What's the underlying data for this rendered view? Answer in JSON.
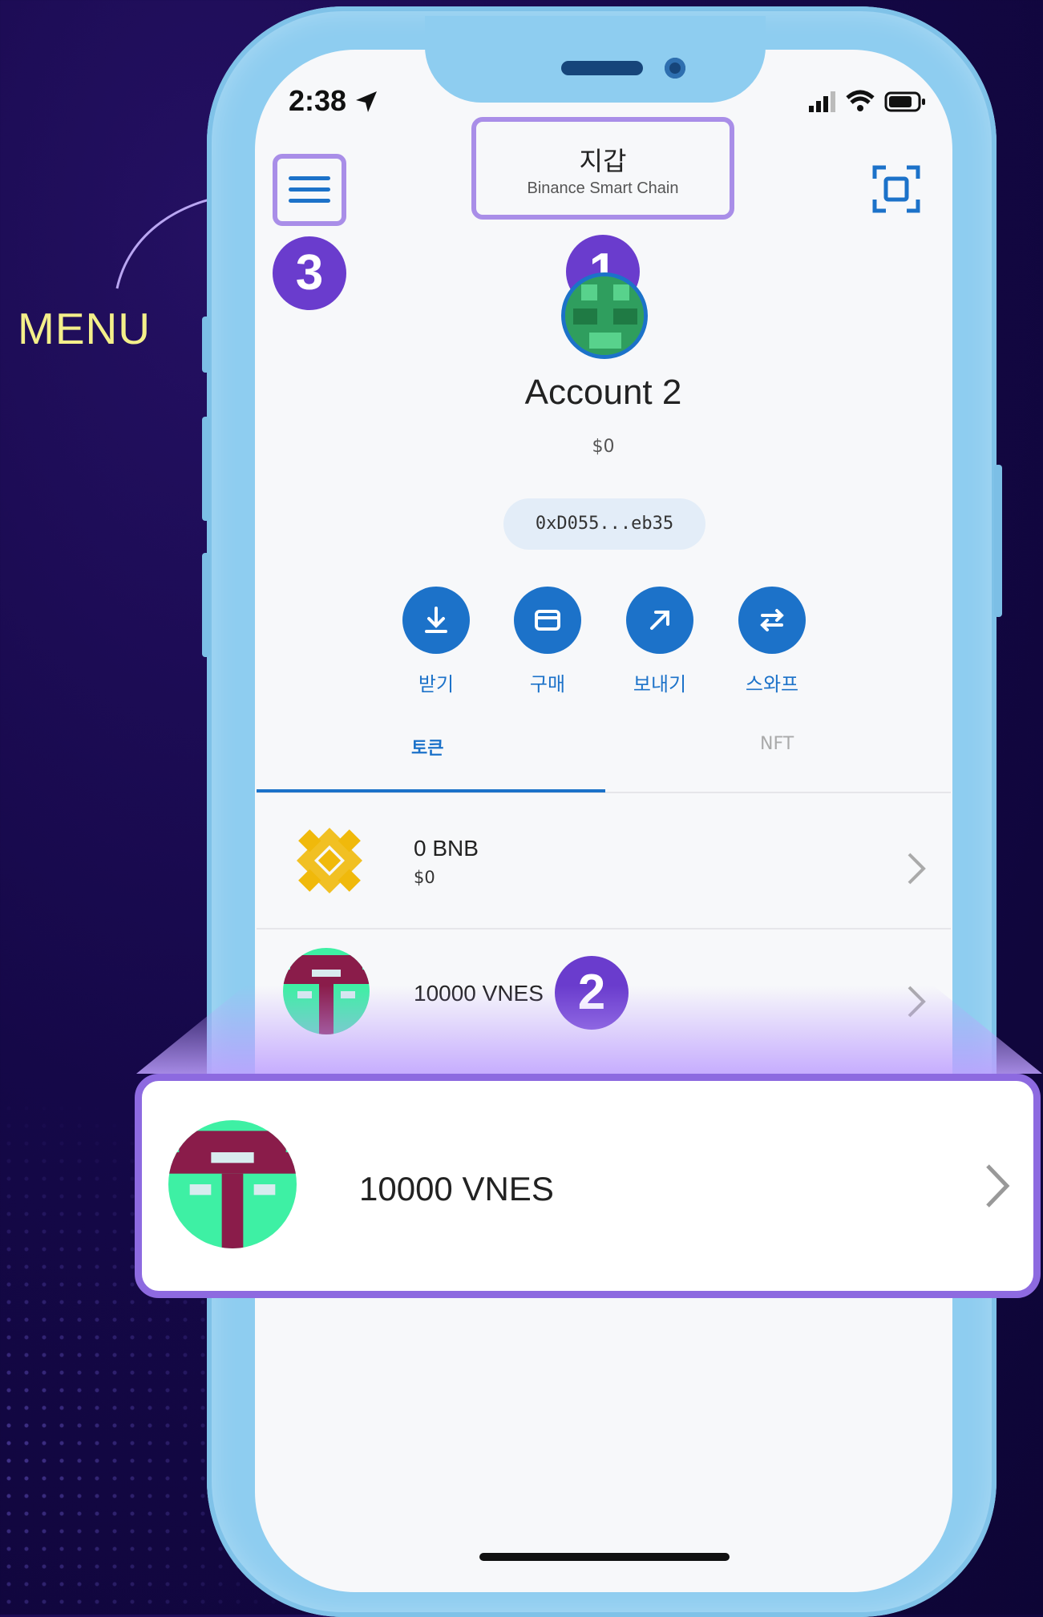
{
  "annotation": {
    "menu_label": "MENU",
    "badges": [
      "1",
      "2",
      "3"
    ]
  },
  "status_bar": {
    "time": "2:38"
  },
  "header": {
    "title": "지갑",
    "network": "Binance Smart Chain"
  },
  "account": {
    "name": "Account 2",
    "balance": "$0",
    "address": "0xD055...eb35"
  },
  "actions": [
    {
      "label": "받기",
      "icon": "receive-arrow-icon"
    },
    {
      "label": "구매",
      "icon": "card-icon"
    },
    {
      "label": "보내기",
      "icon": "send-arrow-icon"
    },
    {
      "label": "스와프",
      "icon": "swap-icon"
    }
  ],
  "tabs": [
    {
      "label": "토큰",
      "active": true
    },
    {
      "label": "NFT",
      "active": false
    }
  ],
  "tokens": [
    {
      "amount": "0 BNB",
      "fiat": "$0",
      "icon": "bnb-logo-icon"
    },
    {
      "amount": "10000 VNES",
      "fiat": "",
      "icon": "vnes-logo-icon"
    }
  ],
  "callout": {
    "amount": "10000 VNES"
  },
  "colors": {
    "accent_blue": "#1c72c9",
    "highlight_purple": "#a98ee8",
    "badge_purple": "#6a3ccd",
    "menu_label_yellow": "#f4ef8a",
    "bnb_yellow": "#f0b90b",
    "vnes_green": "#3ef0a4",
    "vnes_maroon": "#8a1c4a"
  }
}
